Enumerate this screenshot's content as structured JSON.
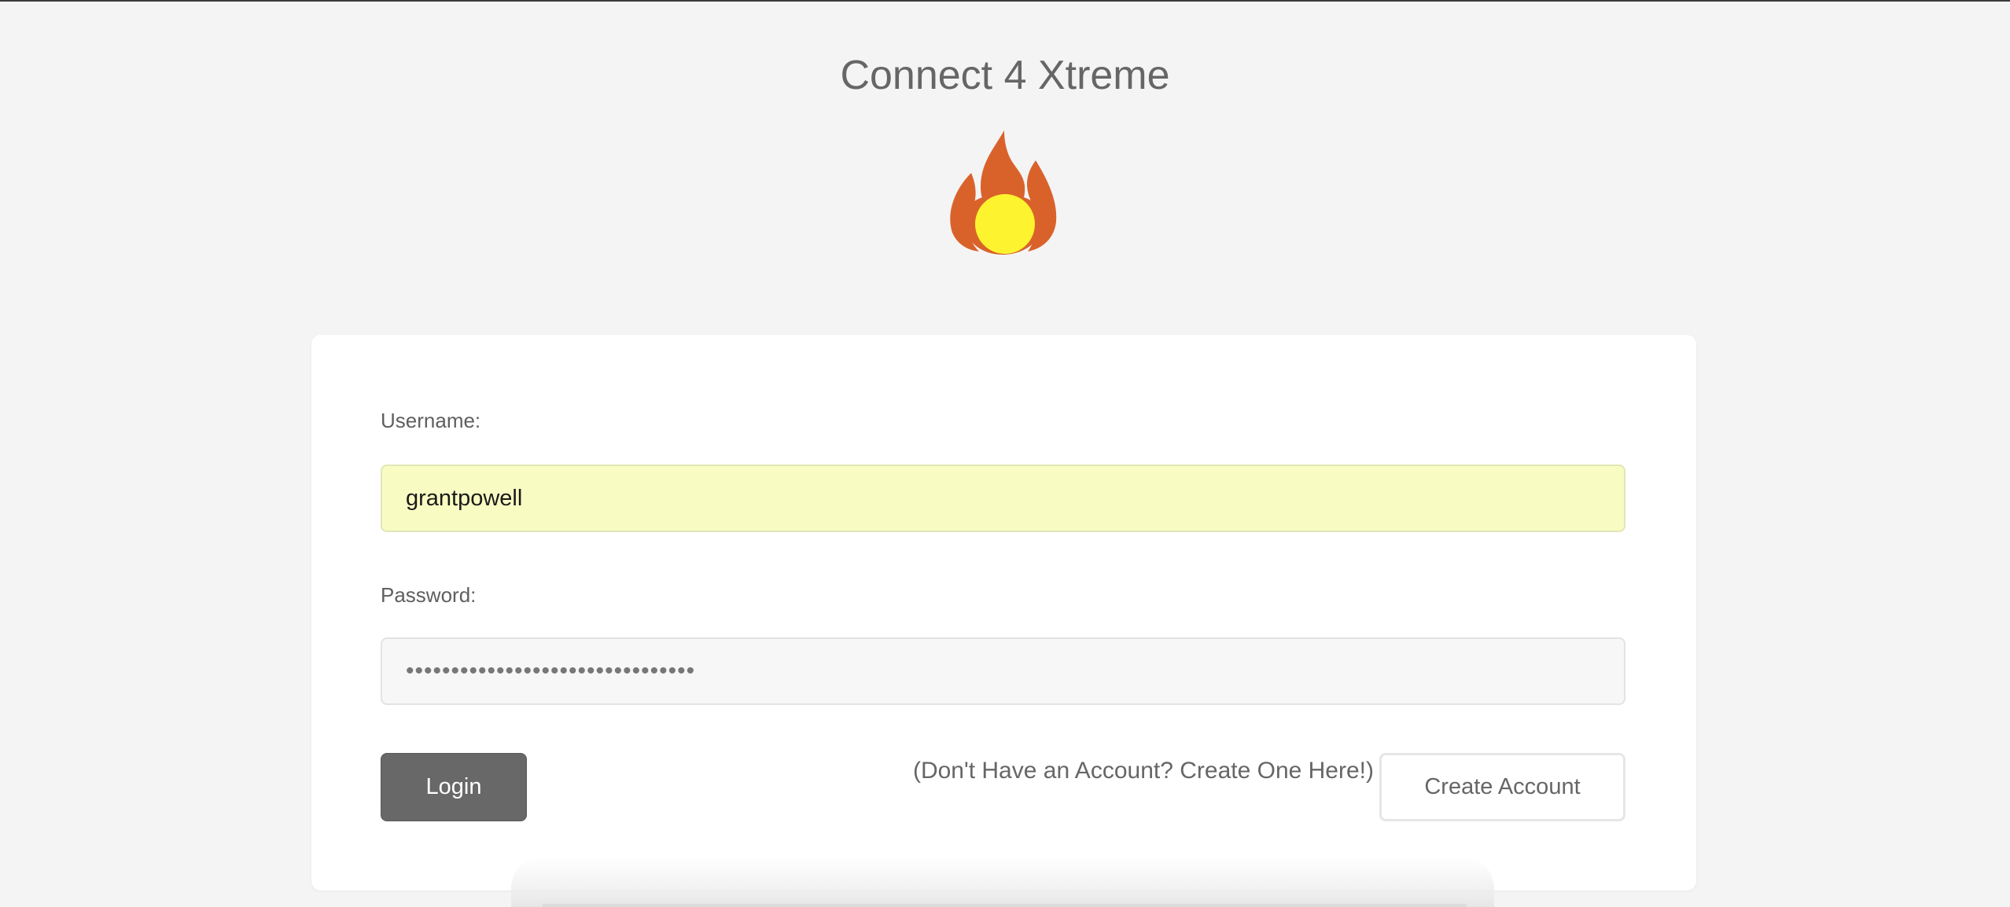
{
  "header": {
    "title": "Connect 4 Xtreme",
    "logo_icon": "flame-ball-icon",
    "flame_color": "#d9622b",
    "ball_color": "#fdf42f"
  },
  "login_form": {
    "username_label": "Username:",
    "username_value": "grantpowell",
    "password_label": "Password:",
    "password_value": "••••••••••••••••••••••••••••••••",
    "login_button": "Login",
    "signup_hint": "(Don't Have an Account? Create One Here!)",
    "create_account_button": "Create Account"
  },
  "colors": {
    "background": "#f4f4f4",
    "card": "#ffffff",
    "username_fill": "#f9fcc2",
    "login_button": "#686868"
  }
}
